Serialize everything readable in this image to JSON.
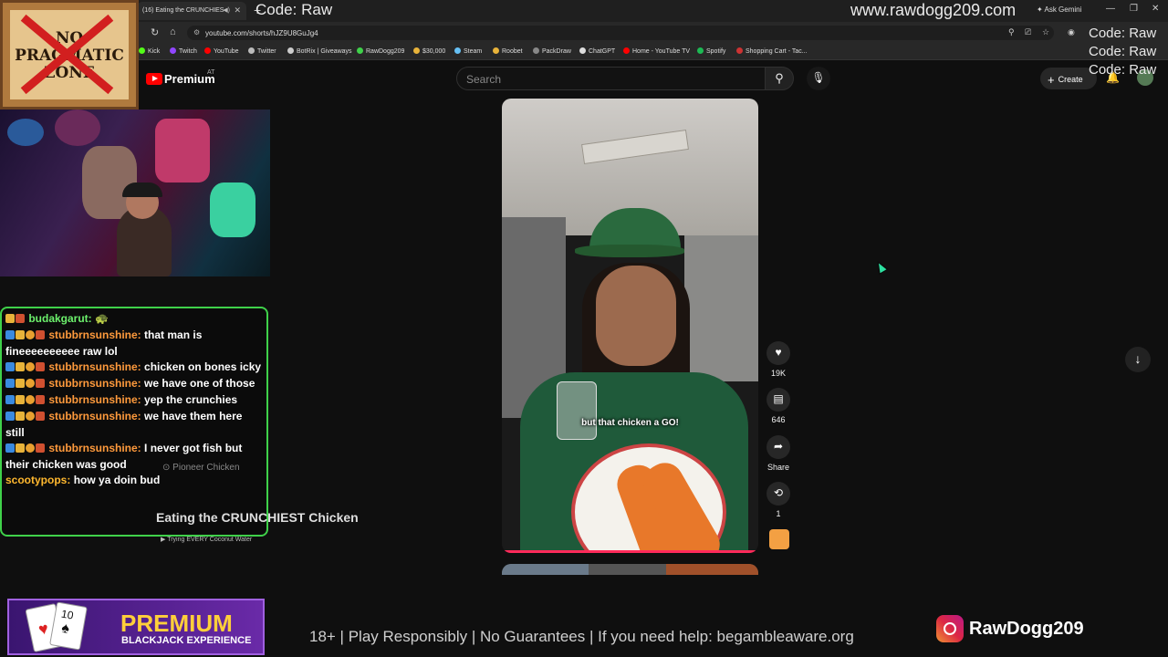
{
  "browser": {
    "tab_title": "(16) Eating the CRUNCHIES",
    "url": "youtube.com/shorts/hJZ9U8GuJg4",
    "gemini_label": "Ask Gemini",
    "bookmarks": [
      {
        "label": "Kick",
        "color": "#53fc18"
      },
      {
        "label": "Twitch",
        "color": "#9146ff"
      },
      {
        "label": "YouTube",
        "color": "#ff0000"
      },
      {
        "label": "Twitter",
        "color": "#bbbbbb"
      },
      {
        "label": "BotRix | Giveaways",
        "color": "#cccccc"
      },
      {
        "label": "RawDogg209",
        "color": "#3fd14a"
      },
      {
        "label": "$30,000",
        "color": "#e8b33a"
      },
      {
        "label": "Steam",
        "color": "#66c0f4"
      },
      {
        "label": "Roobet",
        "color": "#e8b33a"
      },
      {
        "label": "PackDraw",
        "color": "#888888"
      },
      {
        "label": "ChatGPT",
        "color": "#dddddd"
      },
      {
        "label": "Home - YouTube TV",
        "color": "#ff0000"
      },
      {
        "label": "Spotify",
        "color": "#1db954"
      },
      {
        "label": "Shopping Cart - Tac...",
        "color": "#cc3333"
      }
    ]
  },
  "overlay": {
    "code_label": "Code: Raw",
    "site_url": "www.rawdogg209.com",
    "code_stack": [
      "Code: Raw",
      "Code: Raw",
      "Code: Raw"
    ],
    "sign_text": "NO PRAGMATIC ZONE",
    "premium_title": "PREMIUM",
    "premium_subtitle": "BLACKJACK EXPERIENCE",
    "premium_card_value": "10",
    "disclaimer": "18+ | Play Responsibly | No Guarantees | If you need help: begambleaware.org",
    "instagram_handle": "RawDogg209"
  },
  "youtube": {
    "brand": "Premium",
    "country": "AT",
    "search_placeholder": "Search",
    "create_label": "Create"
  },
  "chat": [
    {
      "user": "budakgarut:",
      "msg": "🐢",
      "color": "u-green"
    },
    {
      "user": "stubbrnsunshine:",
      "msg": "that man is fineeeeeeeeee raw lol",
      "color": "u-orange"
    },
    {
      "user": "stubbrnsunshine:",
      "msg": "chicken on bones icky",
      "color": "u-orange"
    },
    {
      "user": "stubbrnsunshine:",
      "msg": "we have one of those",
      "color": "u-orange"
    },
    {
      "user": "stubbrnsunshine:",
      "msg": "yep the crunchies",
      "color": "u-orange"
    },
    {
      "user": "stubbrnsunshine:",
      "msg": "we have them here still",
      "color": "u-orange"
    },
    {
      "user": "stubbrnsunshine:",
      "msg": "I never got fish but their chicken was good",
      "color": "u-orange"
    },
    {
      "user": "scootypops:",
      "msg": "how ya doin bud",
      "color": "u-gold"
    }
  ],
  "short": {
    "caption": "but that chicken a GO!",
    "title": "Eating the CRUNCHIEST Chicken",
    "location": "Pioneer Chicken",
    "playlist": "Trying EVERY Coconut Water",
    "likes": "19K",
    "comments": "646",
    "share_label": "Share",
    "remix_count": "1"
  }
}
